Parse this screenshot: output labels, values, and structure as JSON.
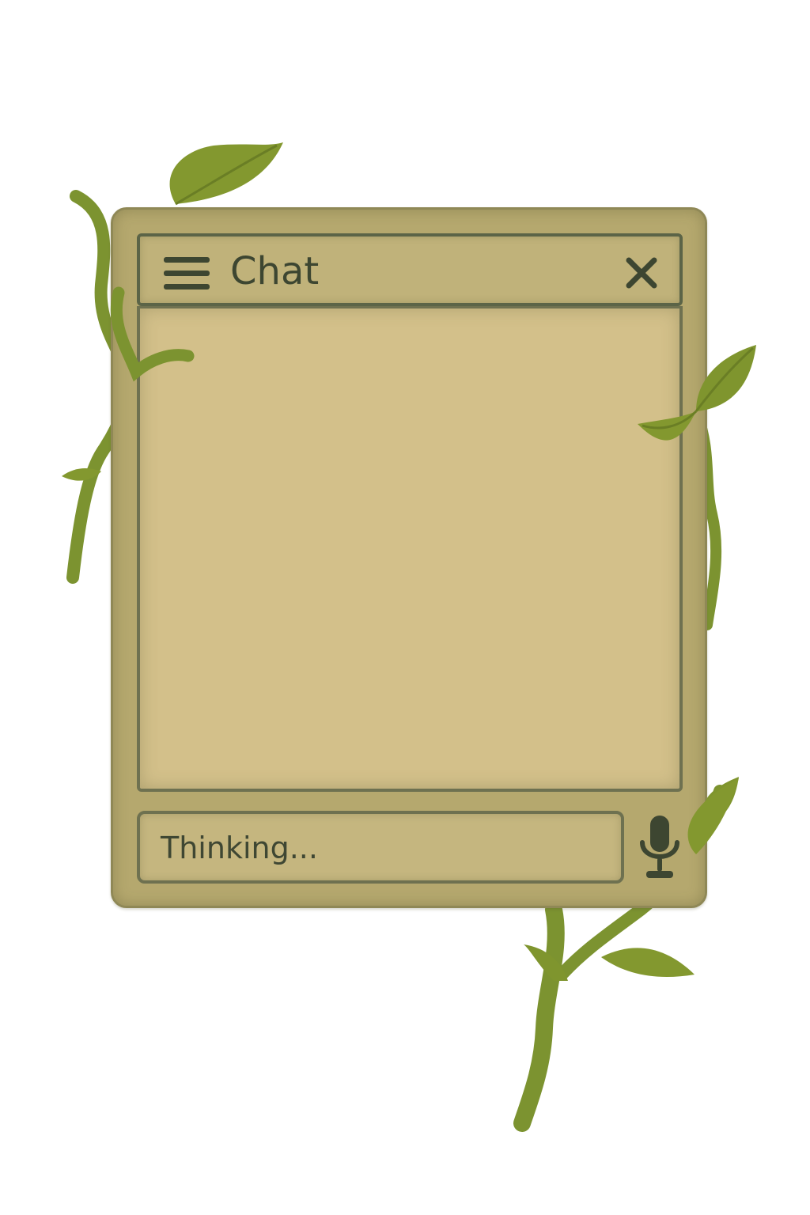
{
  "window": {
    "title": "Chat"
  },
  "toolbar": {
    "menu_icon": "hamburger-menu-icon",
    "close_icon": "close-x-icon"
  },
  "messages": [],
  "input": {
    "value": "Thinking...",
    "mic_icon": "microphone-icon"
  },
  "colors": {
    "frame": "#b5a86e",
    "panel": "#d3c08a",
    "outline": "#5b6447",
    "text": "#3d4631",
    "vine": "#7c9330"
  }
}
